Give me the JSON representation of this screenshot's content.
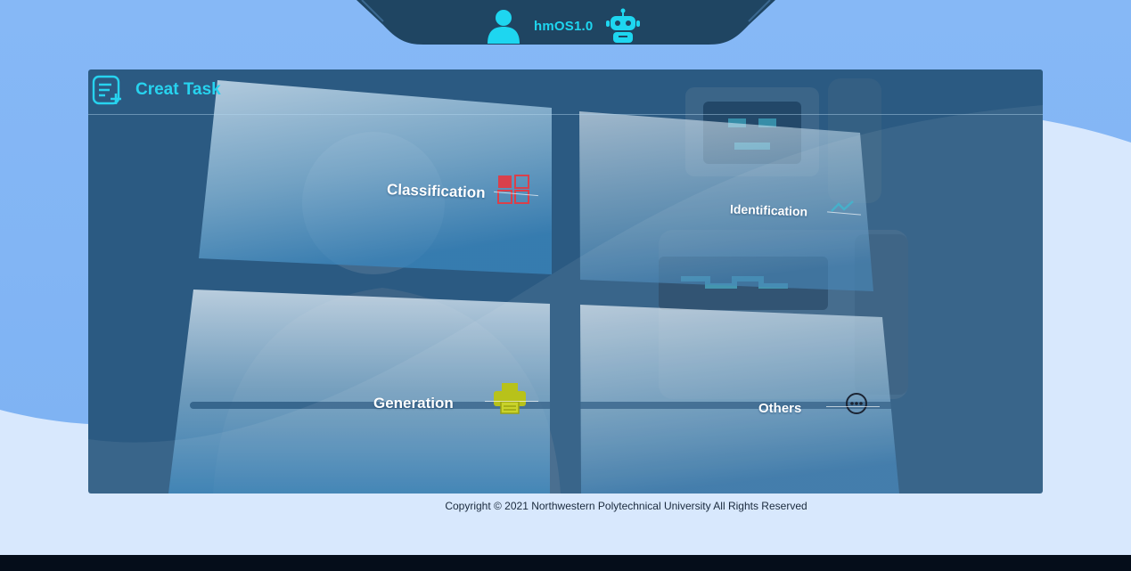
{
  "header": {
    "app_title": "hmOS1.0",
    "left_icon": "user-icon",
    "right_icon": "robot-icon"
  },
  "panel": {
    "title": "Creat Task",
    "title_icon": "create-task-icon"
  },
  "tasks": [
    {
      "label": "Classification",
      "icon": "grid-icon",
      "icon_color": "#d9404b"
    },
    {
      "label": "Identification",
      "icon": "scan-icon",
      "icon_color": "#3fb8d0"
    },
    {
      "label": "Generation",
      "icon": "printer-icon",
      "icon_color": "#b8c21a"
    },
    {
      "label": "Others",
      "icon": "more-icon",
      "icon_color": "#1b2433"
    }
  ],
  "footer": {
    "copyright": "Copyright © 2021 Northwestern Polytechnical University All Rights Reserved"
  },
  "colors": {
    "accent": "#27d3ef",
    "header_dark": "#1f4562",
    "page_top": "#8ab9f5",
    "page_bottom": "#d8e8fd"
  }
}
